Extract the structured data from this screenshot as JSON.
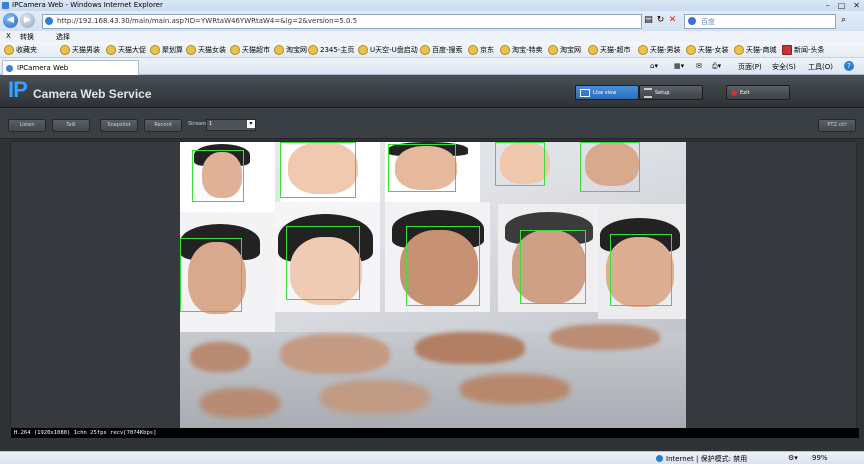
{
  "window": {
    "title": "IPCamera Web - Windows Internet Explorer",
    "controls": [
      "–",
      "□",
      "✕"
    ]
  },
  "address": {
    "url": "http://192.168.43.30/main/main.asp?ID=YWRtaW46YWRtaW4=&lg=2&version=5.0.5",
    "search_placeholder": "百度"
  },
  "menu": {
    "close_x": "X",
    "convert": "转换",
    "select": "选择"
  },
  "favorites": {
    "label": "收藏夹",
    "items": [
      "天猫男装",
      "天猫大促",
      "聚划算",
      "天猫女装",
      "天猫超市",
      "淘宝网",
      "2345-主页",
      "U天空-U盘启动",
      "百度-搜索",
      "京东",
      "淘宝-特卖",
      "淘宝网",
      "天猫-超市",
      "天猫-男装",
      "天猫-女装",
      "天猫-商城",
      "新闻-头条"
    ]
  },
  "tab": {
    "label": "IPCamera Web"
  },
  "commands": {
    "page": "页面(P)",
    "safety": "安全(S)",
    "tools": "工具(O)",
    "help": "?"
  },
  "app": {
    "logo_ip": "IP",
    "logo_text": "Camera Web Service",
    "header_buttons": {
      "live": "Live view",
      "setup": "Setup",
      "exit": "Exit"
    },
    "toolbar": {
      "listen": "Listen",
      "talk": "Talk",
      "snapshot": "Snapshot",
      "record": "Record",
      "stream_label": "Stream",
      "stream_value": "1",
      "ptz": "PTZ ctrl"
    },
    "video_status": "H.264 (1920x1080) 1chn 25fps recv[7074Kbps]"
  },
  "status": {
    "zone": "Internet | 保护模式: 禁用",
    "zoom": "99%"
  },
  "colors": {
    "accent": "#3aa0ff",
    "detect_box": "#3adf3a",
    "live_button": "#2c6db5",
    "exit_button": "#c92a2a"
  }
}
